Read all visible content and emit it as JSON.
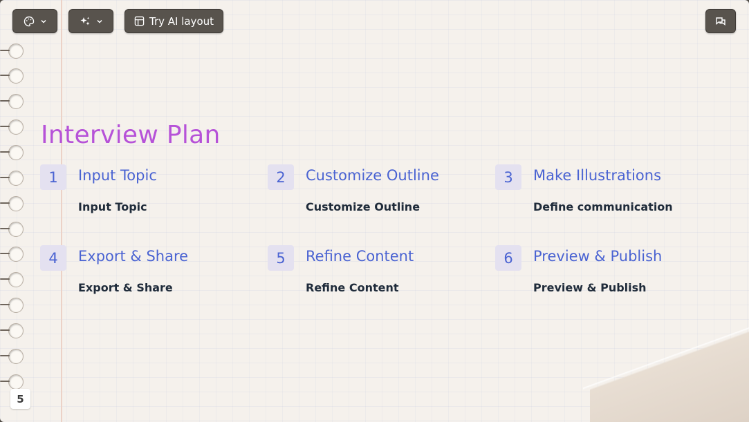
{
  "toolbar": {
    "theme_icon": "palette-icon",
    "magic_icon": "sparkles-icon",
    "ai_layout_icon": "layout-icon",
    "ai_layout_label": "Try AI layout",
    "chat_icon": "chat-bubbles-icon"
  },
  "slide": {
    "title": "Interview Plan",
    "steps": [
      {
        "number": "1",
        "title": "Input Topic",
        "description": "Input Topic"
      },
      {
        "number": "2",
        "title": "Customize Outline",
        "description": "Customize Outline"
      },
      {
        "number": "3",
        "title": "Make Illustrations",
        "description": "Define communication"
      },
      {
        "number": "4",
        "title": "Export & Share",
        "description": "Export & Share"
      },
      {
        "number": "5",
        "title": "Refine Content",
        "description": "Refine Content"
      },
      {
        "number": "6",
        "title": "Preview & Publish",
        "description": "Preview & Publish"
      }
    ]
  },
  "page_number": "5",
  "colors": {
    "title": "#b652d8",
    "accent": "#4a63d2",
    "paper": "#f5f1ec",
    "toolbar_button": "#58534d"
  }
}
